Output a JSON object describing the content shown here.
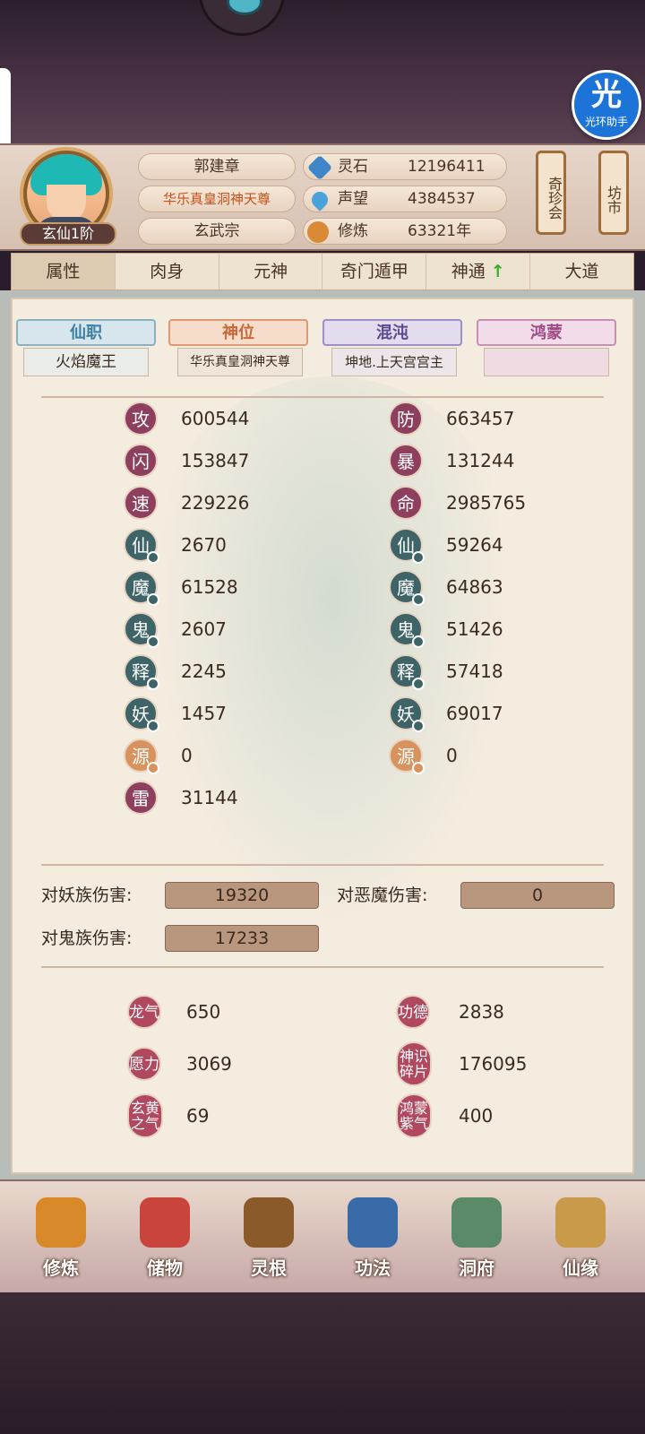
{
  "helper": {
    "icon_text": "光",
    "label": "光环助手"
  },
  "player": {
    "rank": "玄仙1阶",
    "name": "郭建章",
    "title": "华乐真皇洞神天尊",
    "sect": "玄武宗"
  },
  "resources": [
    {
      "label": "灵石",
      "value": "12196411",
      "icon": "spirit-stone-icon"
    },
    {
      "label": "声望",
      "value": "4384537",
      "icon": "prestige-icon"
    },
    {
      "label": "修炼",
      "value": "63321年",
      "icon": "meditation-icon"
    }
  ],
  "side_buttons": {
    "qizhen": "奇珍会",
    "fangshi": "坊市"
  },
  "tabs": [
    "属性",
    "肉身",
    "元神",
    "奇门遁甲",
    "神通",
    "大道"
  ],
  "tab_arrow": "↑",
  "ranks": [
    {
      "label": "仙职",
      "value": "火焰魔王"
    },
    {
      "label": "神位",
      "value": "华乐真皇洞神天尊"
    },
    {
      "label": "混沌",
      "value": "坤地.上天宫宫主"
    },
    {
      "label": "鸿蒙",
      "value": ""
    }
  ],
  "stats_left": [
    {
      "char": "攻",
      "value": "600544",
      "style": "p"
    },
    {
      "char": "闪",
      "value": "153847",
      "style": "p"
    },
    {
      "char": "速",
      "value": "229226",
      "style": "p"
    },
    {
      "char": "仙",
      "value": "2670",
      "style": "g"
    },
    {
      "char": "魔",
      "value": "61528",
      "style": "g"
    },
    {
      "char": "鬼",
      "value": "2607",
      "style": "g"
    },
    {
      "char": "释",
      "value": "2245",
      "style": "g"
    },
    {
      "char": "妖",
      "value": "1457",
      "style": "g"
    },
    {
      "char": "源",
      "value": "0",
      "style": "o"
    },
    {
      "char": "雷",
      "value": "31144",
      "style": "p"
    }
  ],
  "stats_right": [
    {
      "char": "防",
      "value": "663457",
      "style": "p"
    },
    {
      "char": "暴",
      "value": "131244",
      "style": "p"
    },
    {
      "char": "命",
      "value": "2985765",
      "style": "p"
    },
    {
      "char": "仙",
      "value": "59264",
      "style": "g"
    },
    {
      "char": "魔",
      "value": "64863",
      "style": "g"
    },
    {
      "char": "鬼",
      "value": "51426",
      "style": "g"
    },
    {
      "char": "释",
      "value": "57418",
      "style": "g"
    },
    {
      "char": "妖",
      "value": "69017",
      "style": "g"
    },
    {
      "char": "源",
      "value": "0",
      "style": "o"
    }
  ],
  "damage": [
    {
      "label": "对妖族伤害:",
      "value": "19320"
    },
    {
      "label": "对恶魔伤害:",
      "value": "0"
    },
    {
      "label": "对鬼族伤害:",
      "value": "17233"
    }
  ],
  "extra": [
    {
      "label": "龙气",
      "value": "650"
    },
    {
      "label": "功德",
      "value": "2838"
    },
    {
      "label": "愿力",
      "value": "3069"
    },
    {
      "label": "神识碎片",
      "value": "176095"
    },
    {
      "label": "玄黄之气",
      "value": "69"
    },
    {
      "label": "鸿蒙紫气",
      "value": "400"
    }
  ],
  "nav": [
    {
      "label": "修炼",
      "color": "#d88a2a"
    },
    {
      "label": "储物",
      "color": "#c8443c"
    },
    {
      "label": "灵根",
      "color": "#8a5a2a"
    },
    {
      "label": "功法",
      "color": "#3a6aa8"
    },
    {
      "label": "洞府",
      "color": "#5a8a6a"
    },
    {
      "label": "仙缘",
      "color": "#c89a4a"
    }
  ]
}
